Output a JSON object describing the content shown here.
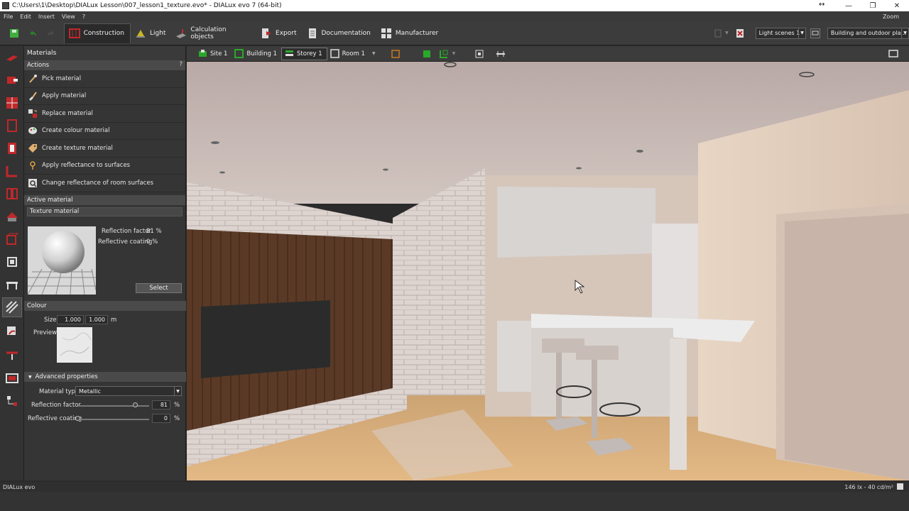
{
  "window": {
    "title": "C:\\Users\\1\\Desktop\\DIALux Lesson\\007_lesson1_texture.evo* - DIALux evo 7  (64-bit)",
    "minimize": "—",
    "maximize": "❐",
    "close": "✕",
    "resize_indicator": "↔"
  },
  "menu": {
    "items": [
      "File",
      "Edit",
      "Insert",
      "View",
      "?"
    ],
    "zoom_label": "Zoom"
  },
  "toolbar": {
    "modes": [
      {
        "label": "Construction",
        "active": true
      },
      {
        "label": "Light",
        "active": false
      },
      {
        "label": "Calculation objects",
        "active": false
      },
      {
        "label": "Export",
        "active": false
      },
      {
        "label": "Documentation",
        "active": false
      },
      {
        "label": "Manufacturer",
        "active": false
      }
    ],
    "light_scenes": "Light scenes 1",
    "view_filter": "Building and outdoor pla..."
  },
  "panel": {
    "title": "Materials",
    "actions_header": "Actions",
    "help": "?",
    "actions": [
      "Pick material",
      "Apply material",
      "Replace material",
      "Create colour material",
      "Create texture material",
      "Apply reflectance to surfaces",
      "Change reflectance of room surfaces"
    ],
    "active_material_header": "Active material",
    "material_name": "Texture material",
    "reflection_factor_label": "Reflection factor",
    "reflection_factor_value": "81 %",
    "reflective_coating_label": "Reflective coating",
    "reflective_coating_value": "0 %",
    "select_button": "Select",
    "colour_header": "Colour",
    "size_label": "Size",
    "size_x": "1.000",
    "size_y": "1.000",
    "size_unit": "m",
    "preview_label": "Preview",
    "advanced_header": "Advanced properties",
    "material_type_label": "Material type",
    "material_type_value": "Metallic",
    "adv_reflection_label": "Reflection factor",
    "adv_reflection_value": "81",
    "adv_reflection_level": 0.81,
    "adv_coating_label": "Reflective coating",
    "adv_coating_value": "0",
    "adv_coating_level": 0,
    "percent": "%"
  },
  "viewport_bar": {
    "crumbs": [
      {
        "label": "Site 1",
        "active": false
      },
      {
        "label": "Building 1",
        "active": false
      },
      {
        "label": "Storey 1",
        "active": true
      },
      {
        "label": "Room 1",
        "active": false
      }
    ]
  },
  "status": {
    "left": "DIALux evo",
    "right": "146 lx - 40 cd/m²"
  },
  "colors": {
    "accent_red": "#c0282a",
    "accent_green": "#2aa82a",
    "panel_bg": "#353535"
  }
}
